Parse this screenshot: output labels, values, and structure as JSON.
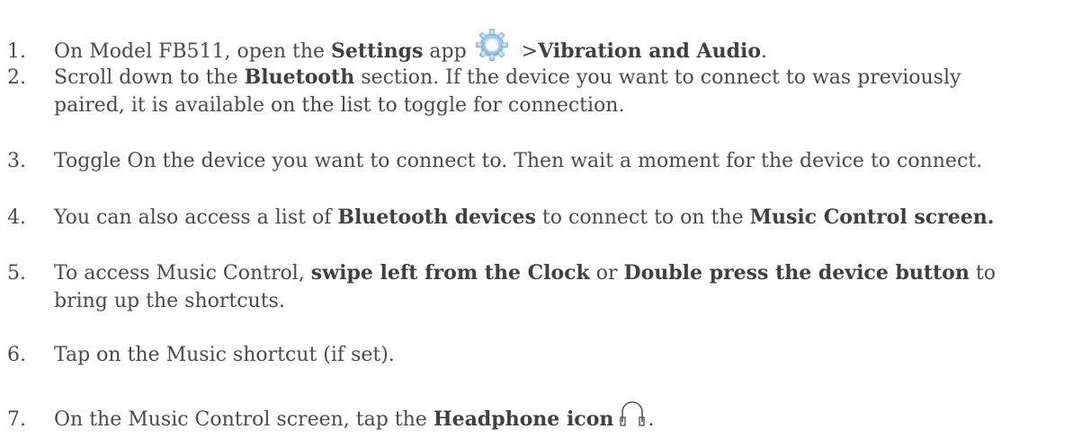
{
  "steps": [
    {
      "num": "1.",
      "t1": "On Model FB511, open the ",
      "b1": "Settings",
      "t2": " app",
      "t3": " >",
      "b2": "Vibration and Audio",
      "t4": "."
    },
    {
      "num": "2.",
      "t1": "Scroll down to the ",
      "b1": "Bluetooth",
      "t2": " section. If the device you want to connect to was previously",
      "line2": "paired, it is available on the list to toggle for connection."
    },
    {
      "num": "3.",
      "t1": "Toggle On the device you want to connect to. Then wait a moment for the device to connect."
    },
    {
      "num": "4.",
      "t1": "You can also access a list of ",
      "b1": "Bluetooth devices",
      "t2": " to connect to on the ",
      "b2": "Music Control screen."
    },
    {
      "num": "5.",
      "t1": "To access Music Control, ",
      "b1": "swipe left from the Clock",
      "t2": " or ",
      "b2": "Double press the device button",
      "t3": " to",
      "line2": "bring up the shortcuts."
    },
    {
      "num": "6.",
      "t1": "Tap on the Music shortcut (if set)."
    },
    {
      "num": "7.",
      "t1": "On the Music Control screen, tap the ",
      "b1": "Headphone icon",
      "t2": "."
    }
  ],
  "icons": {
    "settings": "settings-gear-icon",
    "headphone": "headphone-icon"
  },
  "colors": {
    "text": "#4a4a4a",
    "settings_icon": "#7fb6ee"
  }
}
